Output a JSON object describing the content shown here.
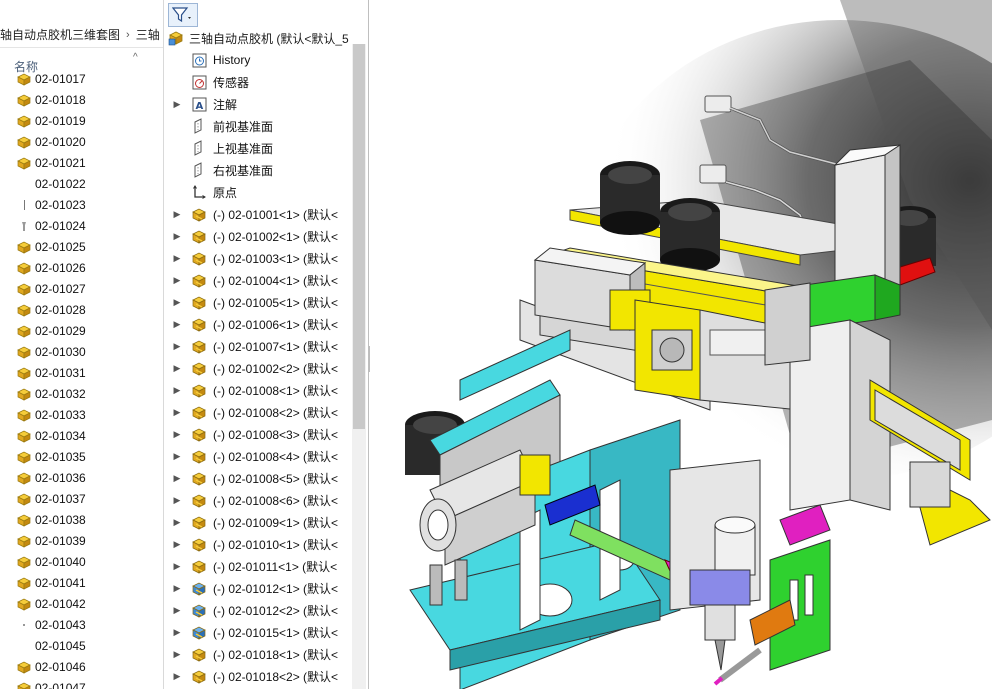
{
  "explorer": {
    "breadcrumb": [
      "轴自动点胶机三维套图",
      "三轴"
    ],
    "column_header": "名称",
    "files": [
      {
        "name": "02-01017",
        "icon": "part-icon"
      },
      {
        "name": "02-01018",
        "icon": "assembly-icon"
      },
      {
        "name": "02-01019",
        "icon": "assembly-icon"
      },
      {
        "name": "02-01020",
        "icon": "assembly-icon"
      },
      {
        "name": "02-01021",
        "icon": "assembly-icon"
      },
      {
        "name": "02-01022",
        "icon": "blank-icon"
      },
      {
        "name": "02-01023",
        "icon": "line-icon"
      },
      {
        "name": "02-01024",
        "icon": "screw-icon"
      },
      {
        "name": "02-01025",
        "icon": "assembly-icon"
      },
      {
        "name": "02-01026",
        "icon": "assembly-icon"
      },
      {
        "name": "02-01027",
        "icon": "assembly-icon"
      },
      {
        "name": "02-01028",
        "icon": "assembly-icon"
      },
      {
        "name": "02-01029",
        "icon": "assembly-icon"
      },
      {
        "name": "02-01030",
        "icon": "assembly-icon"
      },
      {
        "name": "02-01031",
        "icon": "assembly-icon"
      },
      {
        "name": "02-01032",
        "icon": "assembly-icon"
      },
      {
        "name": "02-01033",
        "icon": "assembly-icon"
      },
      {
        "name": "02-01034",
        "icon": "assembly-icon"
      },
      {
        "name": "02-01035",
        "icon": "assembly-icon"
      },
      {
        "name": "02-01036",
        "icon": "assembly-icon"
      },
      {
        "name": "02-01037",
        "icon": "assembly-icon"
      },
      {
        "name": "02-01038",
        "icon": "assembly-icon"
      },
      {
        "name": "02-01039",
        "icon": "assembly-icon"
      },
      {
        "name": "02-01040",
        "icon": "assembly-icon"
      },
      {
        "name": "02-01041",
        "icon": "assembly-icon"
      },
      {
        "name": "02-01042",
        "icon": "assembly-icon"
      },
      {
        "name": "02-01043",
        "icon": "dot-icon"
      },
      {
        "name": "02-01045",
        "icon": "blank-icon"
      },
      {
        "name": "02-01046",
        "icon": "assembly-icon"
      },
      {
        "name": "02-01047",
        "icon": "assembly-icon"
      }
    ]
  },
  "tree": {
    "root_label": "三轴自动点胶机  (默认<默认_5",
    "items": [
      {
        "label": "History",
        "icon": "history-icon",
        "expandable": false
      },
      {
        "label": "传感器",
        "icon": "sensor-icon",
        "expandable": false
      },
      {
        "label": "注解",
        "icon": "annotation-icon",
        "expandable": true
      },
      {
        "label": "前视基准面",
        "icon": "plane-icon",
        "expandable": false
      },
      {
        "label": "上视基准面",
        "icon": "plane-icon",
        "expandable": false
      },
      {
        "label": "右视基准面",
        "icon": "plane-icon",
        "expandable": false
      },
      {
        "label": "原点",
        "icon": "origin-icon",
        "expandable": false
      },
      {
        "label": "(-) 02-01001<1>  (默认<",
        "icon": "subassembly-icon",
        "expandable": true
      },
      {
        "label": "(-) 02-01002<1>  (默认<",
        "icon": "subassembly-icon",
        "expandable": true
      },
      {
        "label": "(-) 02-01003<1>  (默认<",
        "icon": "subassembly-icon",
        "expandable": true
      },
      {
        "label": "(-) 02-01004<1>  (默认<",
        "icon": "subassembly-icon",
        "expandable": true
      },
      {
        "label": "(-) 02-01005<1>  (默认<",
        "icon": "subassembly-icon",
        "expandable": true
      },
      {
        "label": "(-) 02-01006<1>  (默认<",
        "icon": "subassembly-icon",
        "expandable": true
      },
      {
        "label": "(-) 02-01007<1>  (默认<",
        "icon": "subassembly-icon",
        "expandable": true
      },
      {
        "label": "(-) 02-01002<2>  (默认<",
        "icon": "subassembly-icon",
        "expandable": true
      },
      {
        "label": "(-) 02-01008<1>  (默认<",
        "icon": "subassembly-icon",
        "expandable": true
      },
      {
        "label": "(-) 02-01008<2>  (默认<",
        "icon": "subassembly-icon",
        "expandable": true
      },
      {
        "label": "(-) 02-01008<3>  (默认<",
        "icon": "subassembly-icon",
        "expandable": true
      },
      {
        "label": "(-) 02-01008<4>  (默认<",
        "icon": "subassembly-icon",
        "expandable": true
      },
      {
        "label": "(-) 02-01008<5>  (默认<",
        "icon": "subassembly-icon",
        "expandable": true
      },
      {
        "label": "(-) 02-01008<6>  (默认<",
        "icon": "subassembly-icon",
        "expandable": true
      },
      {
        "label": "(-) 02-01009<1>  (默认<",
        "icon": "subassembly-icon",
        "expandable": true
      },
      {
        "label": "(-) 02-01010<1>  (默认<",
        "icon": "subassembly-icon",
        "expandable": true
      },
      {
        "label": "(-) 02-01011<1>  (默认<",
        "icon": "subassembly-icon",
        "expandable": true
      },
      {
        "label": "(-) 02-01012<1>  (默认<",
        "icon": "subassembly-blue-icon",
        "expandable": true
      },
      {
        "label": "(-) 02-01012<2>  (默认<",
        "icon": "subassembly-blue-icon",
        "expandable": true
      },
      {
        "label": "(-) 02-01015<1>  (默认<",
        "icon": "subassembly-blue-icon",
        "expandable": true
      },
      {
        "label": "(-) 02-01018<1>  (默认<",
        "icon": "subassembly-icon",
        "expandable": true
      },
      {
        "label": "(-) 02-01018<2>  (默认<",
        "icon": "subassembly-icon",
        "expandable": true
      }
    ]
  },
  "colors": {
    "yellow": "#f2e600",
    "cyan": "#48d8e0",
    "green": "#2fd12f",
    "blue": "#1a2fd0",
    "magenta": "#e020c0",
    "red": "#e01010",
    "orange": "#e07a10",
    "purple": "#8a8ae8",
    "lime": "#7fe060",
    "steel": "#e2e2e6"
  }
}
